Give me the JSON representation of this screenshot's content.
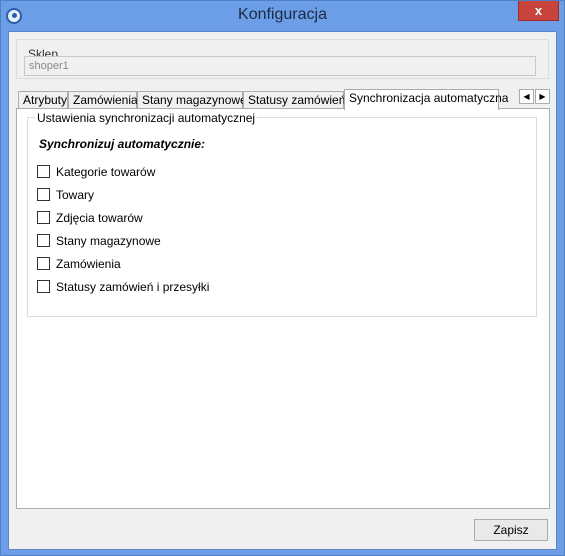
{
  "window": {
    "title": "Konfiguracja",
    "close_glyph": "x",
    "icon": "app-refresh-icon"
  },
  "store": {
    "label": "Sklep",
    "value": "shoper1"
  },
  "tabs": [
    {
      "label": "Atrybuty",
      "active": false
    },
    {
      "label": "Zamówienia",
      "active": false
    },
    {
      "label": "Stany magazynowe",
      "active": false
    },
    {
      "label": "Statusy zamówień",
      "active": false
    },
    {
      "label": "Synchronizacja automatyczna",
      "active": true
    }
  ],
  "tab_scroll": {
    "left_icon": "triangle-left-icon",
    "right_icon": "triangle-right-icon"
  },
  "sync": {
    "group_label": "Ustawienia synchronizacji automatycznej",
    "heading": "Synchronizuj automatycznie:",
    "options": [
      {
        "label": "Kategorie towarów",
        "checked": false
      },
      {
        "label": "Towary",
        "checked": false
      },
      {
        "label": "Zdjęcia towarów",
        "checked": false
      },
      {
        "label": "Stany magazynowe",
        "checked": false
      },
      {
        "label": "Zamówienia",
        "checked": false
      },
      {
        "label": "Statusy zamówień i przesyłki",
        "checked": false
      }
    ]
  },
  "buttons": {
    "save": "Zapisz"
  },
  "colors": {
    "titlebar": "#6b9ee6",
    "close": "#c8443c",
    "dialog_bg": "#f0f0f0"
  }
}
